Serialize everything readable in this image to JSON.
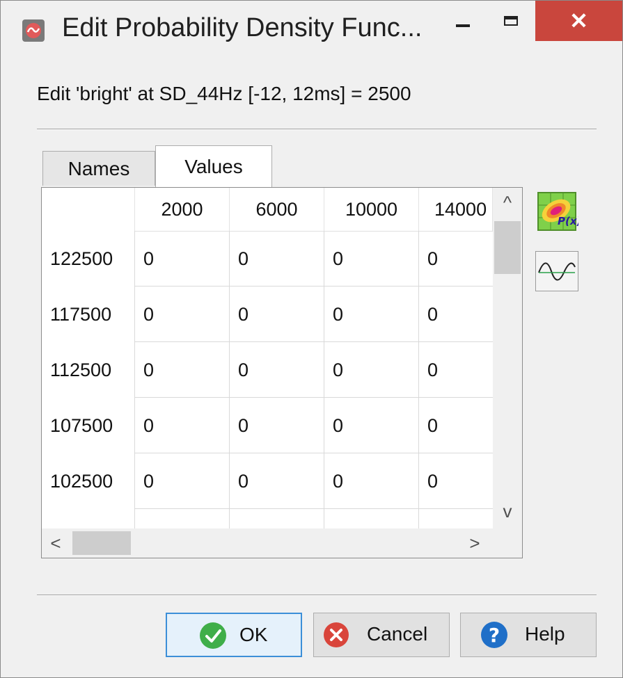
{
  "window": {
    "title": "Edit Probability Density Func...",
    "minimize_icon": "minimize-icon",
    "maximize_icon": "maximize-icon",
    "close_glyph": "✕"
  },
  "header": {
    "text": "Edit 'bright' at SD_44Hz [-12, 12ms] = 2500"
  },
  "tabs": [
    {
      "label": "Names",
      "selected": false
    },
    {
      "label": "Values",
      "selected": true
    }
  ],
  "table": {
    "columns": [
      "2000",
      "6000",
      "10000",
      "14000"
    ],
    "rows": [
      {
        "label": "122500",
        "cells": [
          "0",
          "0",
          "0",
          "0"
        ]
      },
      {
        "label": "117500",
        "cells": [
          "0",
          "0",
          "0",
          "0"
        ]
      },
      {
        "label": "112500",
        "cells": [
          "0",
          "0",
          "0",
          "0"
        ]
      },
      {
        "label": "107500",
        "cells": [
          "0",
          "0",
          "0",
          "0"
        ]
      },
      {
        "label": "102500",
        "cells": [
          "0",
          "0",
          "0",
          "0"
        ]
      }
    ]
  },
  "scroll_arrows": {
    "up": "^",
    "down": "v",
    "left": "<",
    "right": ">"
  },
  "side_tools": {
    "pdf_icon_label": "P(x)"
  },
  "buttons": {
    "ok": "OK",
    "cancel": "Cancel",
    "help": "Help"
  },
  "colors": {
    "close_button": "#c9463d",
    "ok_icon": "#3fae49",
    "cancel_icon": "#d9453b",
    "help_icon": "#1f6fc8",
    "selected_border": "#3c8fd8"
  }
}
